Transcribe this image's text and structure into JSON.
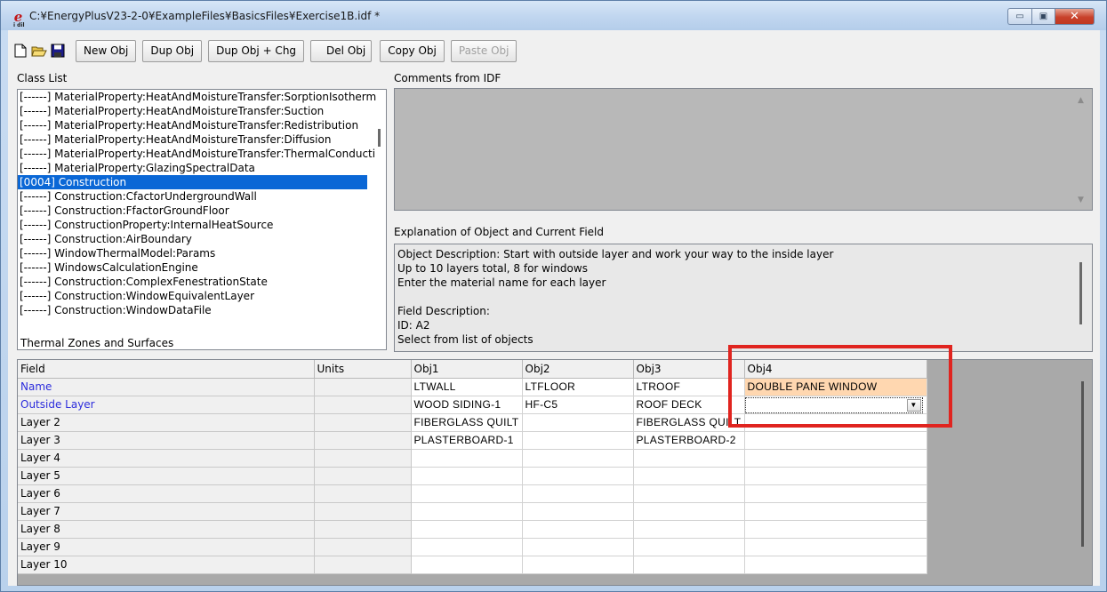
{
  "window": {
    "title": "C:¥EnergyPlusV23-2-0¥ExampleFiles¥BasicsFiles¥Exercise1B.idf *",
    "icon_text": "e",
    "icon_sub": "i dil",
    "min_label": "▭",
    "max_label": "▣",
    "close_label": "✕"
  },
  "toolbar": {
    "new_icon": "new-file-icon",
    "open_icon": "open-folder-icon",
    "save_icon": "save-disk-icon",
    "new_obj": "New Obj",
    "dup_obj": "Dup Obj",
    "dup_obj_chg": "Dup Obj + Chg",
    "del_obj": "Del Obj",
    "copy_obj": "Copy Obj",
    "paste_obj": "Paste Obj"
  },
  "class_list": {
    "label": "Class List",
    "items": [
      "[------]  MaterialProperty:HeatAndMoistureTransfer:SorptionIsotherm",
      "[------]  MaterialProperty:HeatAndMoistureTransfer:Suction",
      "[------]  MaterialProperty:HeatAndMoistureTransfer:Redistribution",
      "[------]  MaterialProperty:HeatAndMoistureTransfer:Diffusion",
      "[------]  MaterialProperty:HeatAndMoistureTransfer:ThermalConducti",
      "[------]  MaterialProperty:GlazingSpectralData",
      "[0004]  Construction",
      "[------]  Construction:CfactorUndergroundWall",
      "[------]  Construction:FfactorGroundFloor",
      "[------]  ConstructionProperty:InternalHeatSource",
      "[------]  Construction:AirBoundary",
      "[------]  WindowThermalModel:Params",
      "[------]  WindowsCalculationEngine",
      "[------]  Construction:ComplexFenestrationState",
      "[------]  Construction:WindowEquivalentLayer",
      "[------]  Construction:WindowDataFile"
    ],
    "selected_index": 6,
    "group_label": "Thermal Zones and Surfaces"
  },
  "comments": {
    "label": "Comments from IDF",
    "up_arrow": "▲",
    "down_arrow": "▼"
  },
  "explanation": {
    "label": "Explanation of Object and Current Field",
    "lines": [
      "Object Description: Start with outside layer and work your way to the inside layer",
      "Up to 10 layers total, 8 for windows",
      "Enter the material name for each layer",
      "",
      "Field Description:",
      "ID: A2",
      "Select from list of objects"
    ]
  },
  "grid": {
    "headers": [
      "Field",
      "Units",
      "Obj1",
      "Obj2",
      "Obj3",
      "Obj4"
    ],
    "rows": [
      {
        "field": "Name",
        "units": "",
        "obj1": "LTWALL",
        "obj2": "LTFLOOR",
        "obj3": "LTROOF",
        "obj4": "DOUBLE PANE WINDOW"
      },
      {
        "field": "Outside Layer",
        "units": "",
        "obj1": "WOOD SIDING-1",
        "obj2": "HF-C5",
        "obj3": "ROOF DECK",
        "obj4": ""
      },
      {
        "field": "Layer 2",
        "units": "",
        "obj1": "FIBERGLASS QUILT",
        "obj2": "",
        "obj3": "FIBERGLASS QUILT",
        "obj4": ""
      },
      {
        "field": "Layer 3",
        "units": "",
        "obj1": "PLASTERBOARD-1",
        "obj2": "",
        "obj3": "PLASTERBOARD-2",
        "obj4": ""
      },
      {
        "field": "Layer 4",
        "units": "",
        "obj1": "",
        "obj2": "",
        "obj3": "",
        "obj4": ""
      },
      {
        "field": "Layer 5",
        "units": "",
        "obj1": "",
        "obj2": "",
        "obj3": "",
        "obj4": ""
      },
      {
        "field": "Layer 6",
        "units": "",
        "obj1": "",
        "obj2": "",
        "obj3": "",
        "obj4": ""
      },
      {
        "field": "Layer 7",
        "units": "",
        "obj1": "",
        "obj2": "",
        "obj3": "",
        "obj4": ""
      },
      {
        "field": "Layer 8",
        "units": "",
        "obj1": "",
        "obj2": "",
        "obj3": "",
        "obj4": ""
      },
      {
        "field": "Layer 9",
        "units": "",
        "obj1": "",
        "obj2": "",
        "obj3": "",
        "obj4": ""
      },
      {
        "field": "Layer 10",
        "units": "",
        "obj1": "",
        "obj2": "",
        "obj3": "",
        "obj4": ""
      }
    ],
    "dropdown_arrow": "▼"
  },
  "colors": {
    "selection": "#0a67d6",
    "field_blue": "#2c2cdc",
    "highlight_cell": "#ffd7b0",
    "annotation_red": "#e0241f"
  }
}
